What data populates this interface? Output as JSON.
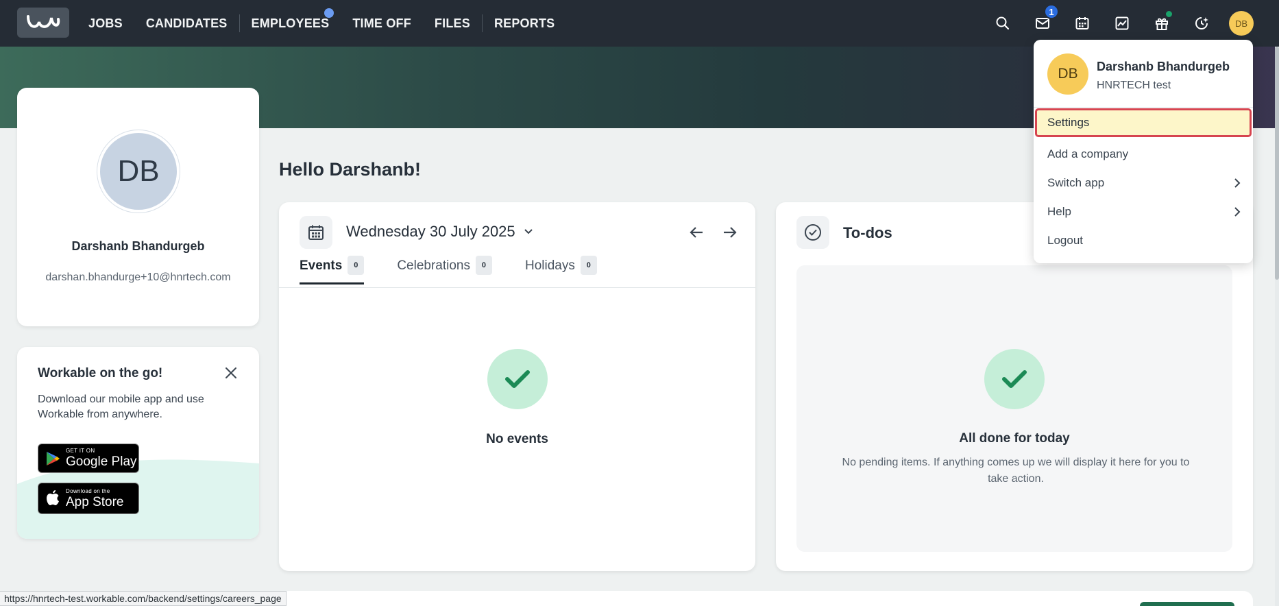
{
  "nav": {
    "links": [
      {
        "label": "JOBS"
      },
      {
        "label": "CANDIDATES"
      },
      {
        "label": "EMPLOYEES"
      },
      {
        "label": "TIME OFF"
      },
      {
        "label": "FILES"
      },
      {
        "label": "REPORTS"
      }
    ],
    "inbox_badge": "1",
    "avatar_initials": "DB"
  },
  "profile": {
    "initials": "DB",
    "name": "Darshanb Bhandurgeb",
    "email": "darshan.bhandurge+10@hnrtech.com"
  },
  "mobile_promo": {
    "title": "Workable on the go!",
    "description": "Download our mobile app and use Workable from anywhere.",
    "google_play_small": "GET IT ON",
    "google_play_big": "Google Play",
    "app_store_small": "Download on the",
    "app_store_big": "App Store"
  },
  "greeting": "Hello Darshanb!",
  "events": {
    "date": "Wednesday 30 July 2025",
    "tabs": [
      {
        "label": "Events",
        "count": "0"
      },
      {
        "label": "Celebrations",
        "count": "0"
      },
      {
        "label": "Holidays",
        "count": "0"
      }
    ],
    "empty_title": "No events"
  },
  "todos": {
    "title": "To-dos",
    "empty_title": "All done for today",
    "empty_desc": "No pending items. If anything comes up we will display it here for you to take action."
  },
  "dropdown": {
    "initials": "DB",
    "name": "Darshanb Bhandurgeb",
    "company": "HNRTECH test",
    "items": [
      {
        "label": "Settings"
      },
      {
        "label": "Add a company"
      },
      {
        "label": "Switch app"
      },
      {
        "label": "Help"
      },
      {
        "label": "Logout"
      }
    ]
  },
  "status_url": "https://hnrtech-test.workable.com/backend/settings/careers_page",
  "colors": {
    "nav_bg": "#252c35",
    "accent_green": "#1f6e4f",
    "check_bg": "#c5eed8",
    "check_color": "#1b8a55",
    "avatar_yellow": "#f7cb59",
    "highlight_border": "#d64550"
  }
}
